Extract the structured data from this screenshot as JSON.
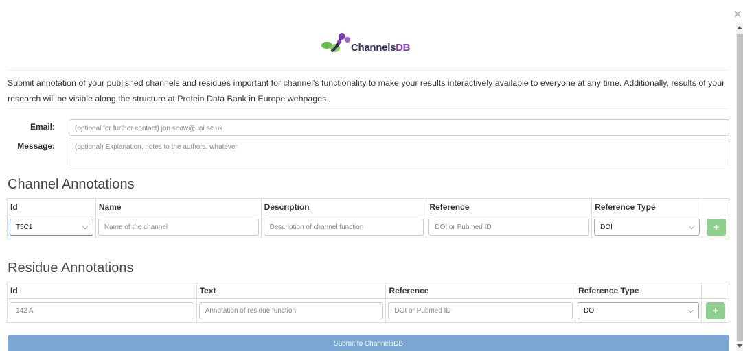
{
  "logo": {
    "name_main": "Channels",
    "name_accent": "DB",
    "colors": {
      "green": "#6cbf4a",
      "purple": "#7b3fb0",
      "dark": "#2e2e5c"
    }
  },
  "window": {
    "close_icon": "close-icon"
  },
  "intro": "Submit annotation of your published channels and residues important for channel's functionality to make your results interactively available to everyone at any time. Additionally, results of your research will be visible along the structure at Protein Data Bank in Europe webpages.",
  "contact": {
    "email_label": "Email:",
    "email_placeholder": "(optional for further contact) jon.snow@uni.ac.uk",
    "message_label": "Message:",
    "message_placeholder": "(optional) Explanation, notes to the authors, whatever"
  },
  "channel": {
    "title": "Channel Annotations",
    "headers": [
      "Id",
      "Name",
      "Description",
      "Reference",
      "Reference Type"
    ],
    "row": {
      "id_value": "T5C1",
      "name_placeholder": "Name of the channel",
      "description_placeholder": "Description of channel function",
      "reference_placeholder": "DOI or Pubmed ID",
      "reference_type": "DOI",
      "add_label": "+"
    }
  },
  "residue": {
    "title": "Residue Annotations",
    "headers": [
      "Id",
      "Text",
      "Reference",
      "Reference Type"
    ],
    "row": {
      "id_placeholder": "142 A",
      "text_placeholder": "Annotation of residue function",
      "reference_placeholder": "DOI or Pubmed ID",
      "reference_type": "DOI",
      "add_label": "+"
    }
  },
  "submit_label": "Submit to ChannelsDB",
  "colors": {
    "submit": "#7ba7d3",
    "add_button": "#8fd08f",
    "focus": "#5b8fd6"
  }
}
